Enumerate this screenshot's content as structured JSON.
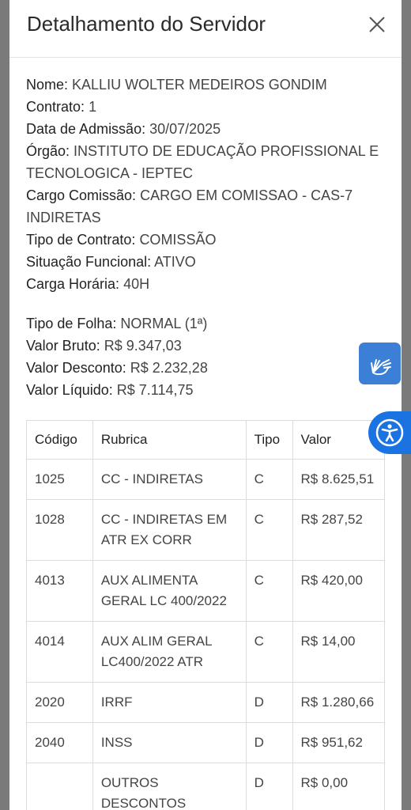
{
  "modal": {
    "title": "Detalhamento do Servidor",
    "close_icon": "close-icon"
  },
  "servidor": {
    "nome_label": "Nome:",
    "nome": "KALLIU WOLTER MEDEIROS GONDIM",
    "contrato_label": "Contrato:",
    "contrato": "1",
    "admissao_label": "Data de Admissão:",
    "admissao": "30/07/2025",
    "orgao_label": "Órgão:",
    "orgao": "INSTITUTO DE EDUCAÇÃO PROFISSIONAL E TECNOLOGICA - IEPTEC",
    "cargo_label": "Cargo Comissão:",
    "cargo": "CARGO EM COMISSAO - CAS-7 INDIRETAS",
    "tipo_contrato_label": "Tipo de Contrato:",
    "tipo_contrato": "COMISSÃO",
    "situacao_label": "Situação Funcional:",
    "situacao": "ATIVO",
    "carga_label": "Carga Horária:",
    "carga": "40H"
  },
  "folha": {
    "tipo_label": "Tipo de Folha:",
    "tipo": "NORMAL (1ª)",
    "bruto_label": "Valor Bruto:",
    "bruto": "R$ 9.347,03",
    "desconto_label": "Valor Desconto:",
    "desconto": "R$ 2.232,28",
    "liquido_label": "Valor Líquido:",
    "liquido": "R$ 7.114,75"
  },
  "table": {
    "headers": [
      "Código",
      "Rubrica",
      "Tipo",
      "Valor"
    ],
    "rows": [
      {
        "codigo": "1025",
        "rubrica": "CC - INDIRETAS",
        "tipo": "C",
        "valor": "R$ 8.625,51"
      },
      {
        "codigo": "1028",
        "rubrica": "CC - INDIRETAS EM ATR EX CORR",
        "tipo": "C",
        "valor": "R$ 287,52"
      },
      {
        "codigo": "4013",
        "rubrica": "AUX ALIMENTA GERAL LC 400/2022",
        "tipo": "C",
        "valor": "R$ 420,00"
      },
      {
        "codigo": "4014",
        "rubrica": "AUX ALIM GERAL LC400/2022 ATR",
        "tipo": "C",
        "valor": "R$ 14,00"
      },
      {
        "codigo": "2020",
        "rubrica": "IRRF",
        "tipo": "D",
        "valor": "R$ 1.280,66"
      },
      {
        "codigo": "2040",
        "rubrica": "INSS",
        "tipo": "D",
        "valor": "R$ 951,62"
      },
      {
        "codigo": "",
        "rubrica": "OUTROS DESCONTOS",
        "tipo": "D",
        "valor": "R$ 0,00"
      }
    ]
  },
  "floating": {
    "libras_icon": "sign-language-hands-icon",
    "accessibility_icon": "accessibility-person-icon",
    "colors": {
      "libras": "#3b7fd6",
      "accessibility": "#1a73e0"
    }
  }
}
